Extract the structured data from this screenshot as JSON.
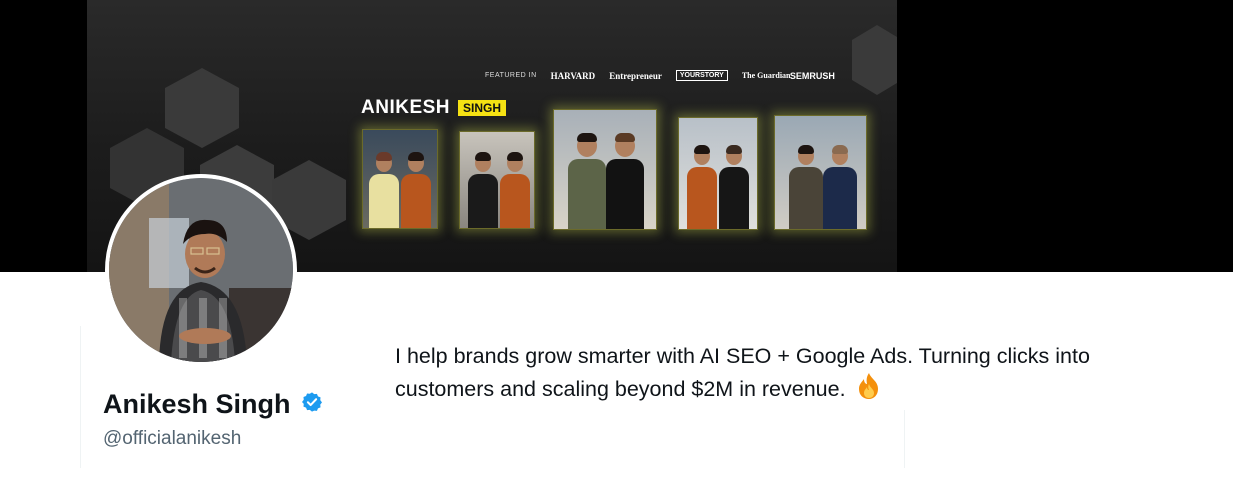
{
  "banner": {
    "featured_label": "FEATURED IN",
    "logos": [
      "HARVARD",
      "Entrepreneur",
      "YOURSTORY",
      "The Guardian",
      "SEMRUSH"
    ],
    "title_first": "ANIKESH",
    "title_last": "SINGH",
    "photos_count": 5
  },
  "profile": {
    "name": "Anikesh Singh",
    "handle": "@officialanikesh",
    "verified": true,
    "bio": "I help brands grow smarter with AI SEO + Google Ads. Turning clicks into customers and scaling beyond $2M in revenue.",
    "bio_emoji": "fire-emoji"
  },
  "colors": {
    "verified": "#1d9bf0",
    "name": "#0f1419",
    "handle": "#536471",
    "accent_yellow": "#f5e113"
  }
}
